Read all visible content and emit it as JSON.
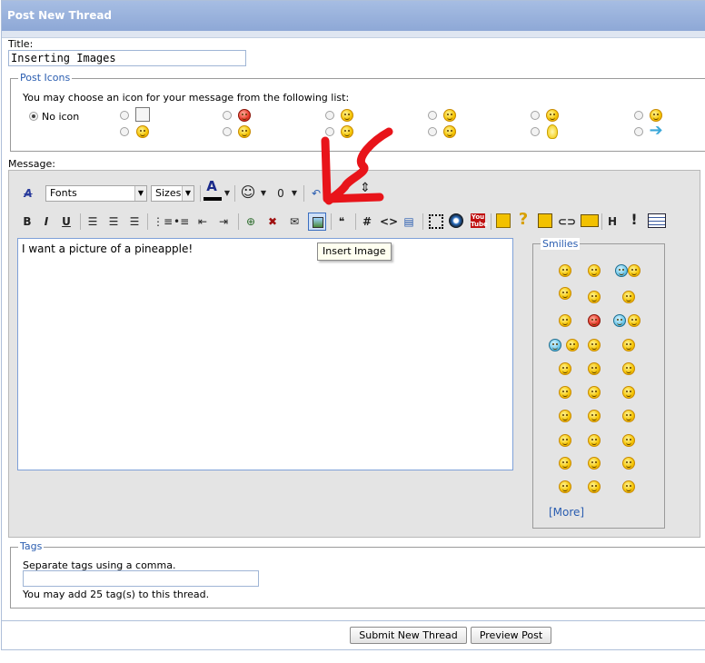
{
  "header": {
    "title": "Post New Thread"
  },
  "title_field": {
    "label": "Title:",
    "value": "Inserting Images"
  },
  "post_icons": {
    "legend": "Post Icons",
    "instruction": "You may choose an icon for your message from the following list:",
    "no_icon_label": "No icon"
  },
  "message": {
    "label": "Message:",
    "fonts_select": "Fonts",
    "sizes_select": "Sizes",
    "body_text": "I want a picture of a pineapple!",
    "tooltip": "Insert Image",
    "toolbar_glyphs": {
      "bold": "B",
      "italic": "I",
      "underline": "U",
      "hash": "#",
      "code": "<>",
      "question": "?",
      "exclaim": "!",
      "font_color": "A",
      "attach": "0"
    }
  },
  "smilies": {
    "legend": "Smilies",
    "more_link": "[More]"
  },
  "tags": {
    "legend": "Tags",
    "instruction": "Separate tags using a comma.",
    "limit_text": "You may add 25 tag(s) to this thread."
  },
  "buttons": {
    "submit": "Submit New Thread",
    "preview": "Preview Post"
  },
  "colors": {
    "accent": "#2a5db0",
    "header_bg": "#a6bde3",
    "annotation_red": "#e8141a"
  }
}
